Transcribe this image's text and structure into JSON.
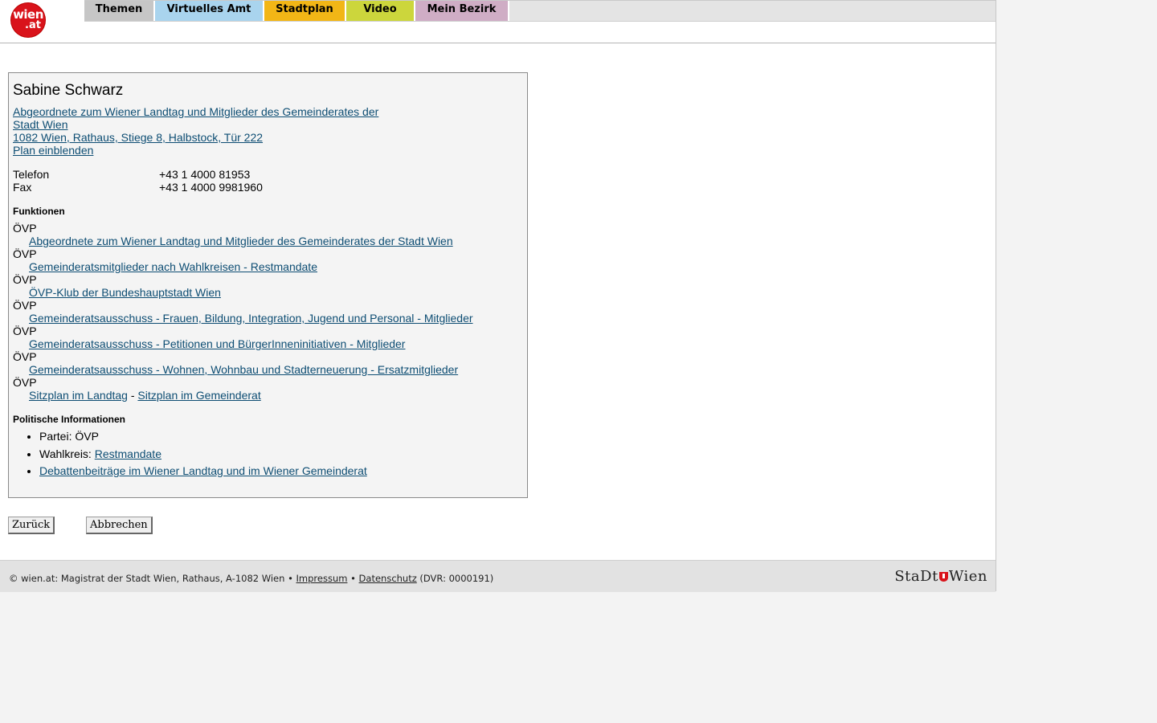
{
  "header": {
    "logo_text_1": "wien",
    "logo_text_2": ".at",
    "tabs": [
      {
        "label": "Themen",
        "color": "#c6c6c6"
      },
      {
        "label": "Virtuelles Amt",
        "color": "#a9d4ee"
      },
      {
        "label": "Stadtplan",
        "color": "#f2b616"
      },
      {
        "label": "Video",
        "color": "#ccd63c"
      },
      {
        "label": "Mein Bezirk",
        "color": "#cfadc5"
      }
    ]
  },
  "person": {
    "name": "Sabine Schwarz",
    "office_link_1": "Abgeordnete zum Wiener Landtag und Mitglieder des Gemeinderates der",
    "office_link_2": "Stadt Wien",
    "address": "1082 Wien, Rathaus, Stiege 8, Halbstock, Tür 222",
    "map_link": "Plan einblenden",
    "phone_label": "Telefon",
    "phone_value": "+43 1 4000 81953",
    "fax_label": "Fax",
    "fax_value": "+43 1 4000 9981960"
  },
  "functions": {
    "heading": "Funktionen",
    "items": [
      {
        "party": "ÖVP",
        "role": "Abgeordnete zum Wiener Landtag und Mitglieder des Gemeinderates der Stadt Wien"
      },
      {
        "party": "ÖVP",
        "role": "Gemeinderatsmitglieder nach Wahlkreisen - Restmandate"
      },
      {
        "party": "ÖVP",
        "role": "ÖVP-Klub der Bundeshauptstadt Wien"
      },
      {
        "party": "ÖVP",
        "role": "Gemeinderatsausschuss - Frauen, Bildung, Integration, Jugend und Personal - Mitglieder"
      },
      {
        "party": "ÖVP",
        "role": "Gemeinderatsausschuss - Petitionen und BürgerInneninitiativen - Mitglieder"
      },
      {
        "party": "ÖVP",
        "role": "Gemeinderatsausschuss - Wohnen, Wohnbau und Stadterneuerung - Ersatzmitglieder"
      }
    ],
    "last_party": "ÖVP",
    "seat_landtag": "Sitzplan im Landtag",
    "seat_sep": " - ",
    "seat_gemeinderat": "Sitzplan im Gemeinderat"
  },
  "political": {
    "heading": "Politische Informationen",
    "party_label": "Partei: ÖVP",
    "wahlkreis_label": "Wahlkreis: ",
    "wahlkreis_link": "Restmandate",
    "debates_link": "Debattenbeiträge im Wiener Landtag und im Wiener Gemeinderat"
  },
  "buttons": {
    "back": "Zurück",
    "cancel": "Abbrechen"
  },
  "footer": {
    "text": "© wien.at: Magistrat der Stadt Wien, Rathaus, A-1082 Wien • ",
    "impressum": "Impressum",
    "bullet": " • ",
    "datenschutz": "Datenschutz",
    "dvr": " (DVR: 0000191)",
    "logo_left": "StaDt",
    "logo_right": "Wien"
  }
}
